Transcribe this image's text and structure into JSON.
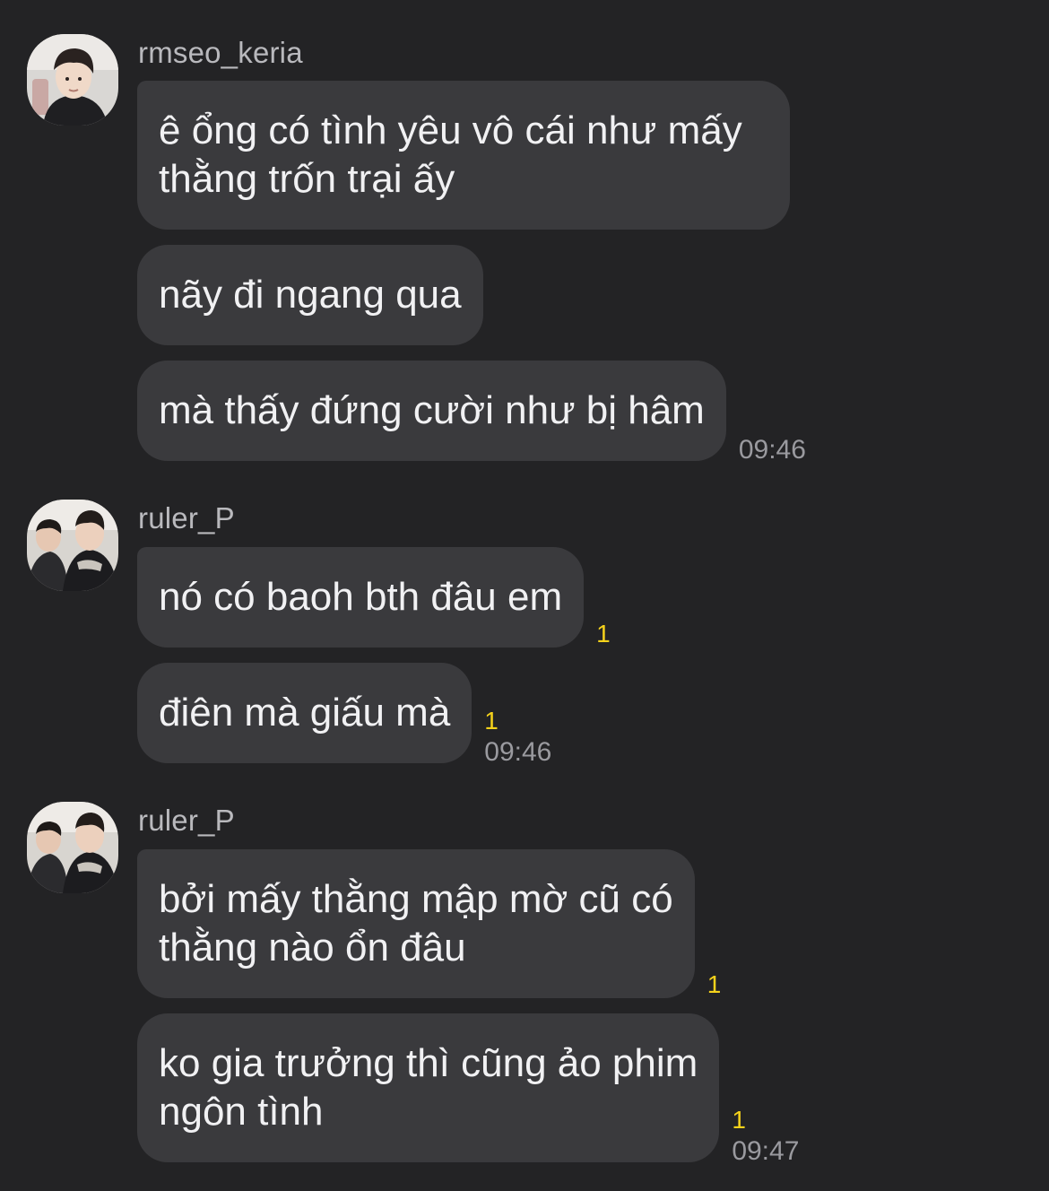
{
  "conversation": {
    "groups": [
      {
        "sender": "rmseo_keria",
        "avatar_icon": "user-avatar-photo",
        "messages": [
          {
            "text": "ê ổng có tình yêu vô cái như mấy\nthằng trốn trại ấy",
            "unread": "",
            "time": ""
          },
          {
            "text": "nãy đi ngang qua",
            "unread": "",
            "time": ""
          },
          {
            "text": "mà thấy đứng cười như bị hâm",
            "unread": "",
            "time": "09:46"
          }
        ]
      },
      {
        "sender": "ruler_P",
        "avatar_icon": "user-avatar-photo",
        "messages": [
          {
            "text": "nó có baoh bth đâu em",
            "unread": "1",
            "time": ""
          },
          {
            "text": "điên mà giấu mà",
            "unread": "1",
            "time": "09:46"
          }
        ]
      },
      {
        "sender": "ruler_P",
        "avatar_icon": "user-avatar-photo",
        "messages": [
          {
            "text": "bởi mấy thằng mập mờ cũ có\nthằng nào ổn đâu",
            "unread": "1",
            "time": ""
          },
          {
            "text": "ko gia trưởng thì cũng ảo phim\nngôn tình",
            "unread": "1",
            "time": "09:47"
          }
        ]
      }
    ]
  },
  "colors": {
    "background": "#232325",
    "bubble": "#3a3a3d",
    "unread": "#f5d21b",
    "timestamp": "#9a9a9f",
    "sender": "#b9b9bd"
  }
}
